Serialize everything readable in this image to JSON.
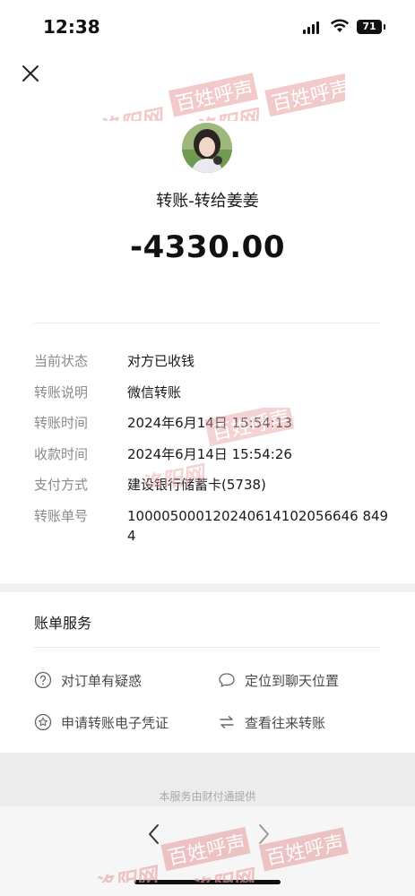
{
  "status_bar": {
    "time": "12:38",
    "battery": "71"
  },
  "transfer": {
    "title": "转账-转给姜姜",
    "amount": "-4330.00"
  },
  "details": [
    {
      "label": "当前状态",
      "value": "对方已收钱"
    },
    {
      "label": "转账说明",
      "value": "微信转账"
    },
    {
      "label": "转账时间",
      "value": "2024年6月14日 15:54:13"
    },
    {
      "label": "收款时间",
      "value": "2024年6月14日 15:54:26"
    },
    {
      "label": "支付方式",
      "value": "建设银行储蓄卡(5738)"
    },
    {
      "label": "转账单号",
      "value": "100005000120240614102056646 8494"
    }
  ],
  "services": {
    "title": "账单服务",
    "items": [
      {
        "label": "对订单有疑惑",
        "icon": "question-circle-icon"
      },
      {
        "label": "定位到聊天位置",
        "icon": "chat-bubble-icon"
      },
      {
        "label": "申请转账电子凭证",
        "icon": "star-circle-icon"
      },
      {
        "label": "查看往来转账",
        "icon": "swap-arrows-icon"
      }
    ]
  },
  "footer": {
    "text": "本服务由财付通提供"
  },
  "watermark": {
    "text": "洛阳网",
    "badge": "百姓呼声",
    "color": "#e8a0a0"
  }
}
